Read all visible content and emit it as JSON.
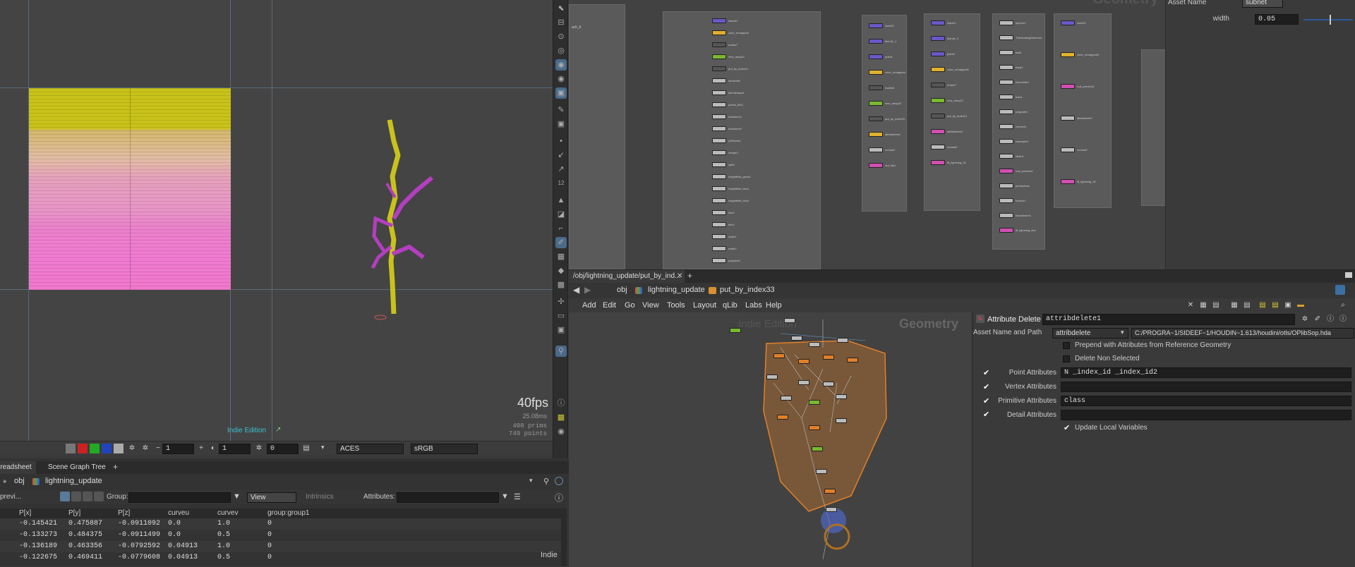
{
  "viewport": {
    "fps": "40fps",
    "ms": "25.08ms",
    "prims": "408  prims",
    "points": "749 points",
    "indie": "Indie Edition",
    "toolbar": {
      "frame_a": "1",
      "frame_b": "1",
      "frame_c": "0",
      "colorspace": "ACES",
      "display": "sRGB"
    }
  },
  "net_top": {
    "watermark": "Geometry",
    "left_label": "ach_tl",
    "nodes_b": [
      "lines30",
      "color_remapped",
      "nodes7",
      "new_ramp21",
      "put_by_index21",
      "timeshift1",
      "blendshape1",
      "points_f810",
      "transform1",
      "transform2",
      "ySDivide1",
      "merge3",
      "split1",
      "heightfield_grow3",
      "heightfield_blur1",
      "heightfield_blur2",
      "blur1",
      "blur2",
      "scale1",
      "scale2",
      "polywire2"
    ],
    "nodes_c": [
      "lines20",
      "blend1_1",
      "point1",
      "color_remapped",
      "nodes6",
      "new_ramp20",
      "put_by_index20",
      "attribdelete1",
      "normal1",
      "out_flat1"
    ],
    "nodes_d": [
      "lines21",
      "blend1_2",
      "point2",
      "color_remapped1",
      "nodes7",
      "new_ramp21",
      "put_by_index21",
      "attribdelete2",
      "normal2",
      "lft_lightning_01"
    ],
    "nodes_e": [
      "sphere1",
      "ThiefrostingDeformer",
      "trail1",
      "blast1",
      "ivtunelrite1",
      "fuse1",
      "polypath1",
      "convert1",
      "resample1",
      "clean1",
      "null_preview1",
      "ptrelaxtrian",
      "bottom1",
      "lookatmore1",
      "lft_lightning_line"
    ],
    "nodes_f": [
      "lines20",
      "color_remapped2",
      "null_preview2",
      "attribdelete7",
      "normal3",
      "lft_lightning_01"
    ]
  },
  "param_top": {
    "asset_name_label": "Asset Name",
    "asset_name_value": "subnet",
    "width_label": "width",
    "width_value": "0.05"
  },
  "right_bottom": {
    "path_tab": "/obj/lightning_update/put_by_ind...",
    "crumbs": [
      "obj",
      "lightning_update",
      "put_by_index33"
    ],
    "menu": [
      "Add",
      "Edit",
      "Go",
      "View",
      "Tools",
      "Layout",
      "qLib",
      "Labs",
      "Help"
    ],
    "watermark_indie": "Indie Edition",
    "watermark_geo": "Geometry",
    "param": {
      "type": "Attribute Delete",
      "name": "attribdelete1",
      "asset_label": "Asset Name and Path",
      "asset_value": "attribdelete",
      "asset_path": "C:/PROGRA~1/SIDEEF~1/HOUDIN~1.613/houdini/otls/OPlibSop.hda",
      "prepend_label": "Prepend with Attributes from Reference Geometry",
      "delete_non_label": "Delete Non Selected",
      "point_label": "Point Attributes",
      "point_value": "N _index_id _index_id2",
      "vertex_label": "Vertex Attributes",
      "vertex_value": "",
      "prim_label": "Primitive Attributes",
      "prim_value": "class",
      "detail_label": "Detail Attributes",
      "detail_value": "",
      "update_label": "Update Local Variables"
    }
  },
  "spreadsheet": {
    "tabs": [
      "Spreadsheet",
      "Scene Graph Tree"
    ],
    "crumbs": [
      "obj",
      "lightning_update"
    ],
    "preview_label": "previ...",
    "group_label": "Group:",
    "view_label": "View",
    "intrinsics_label": "Intrinsics",
    "attributes_label": "Attributes:",
    "indie": "Indie",
    "columns": [
      "P[x]",
      "P[y]",
      "P[z]",
      "curveu",
      "curvev",
      "group:group1"
    ],
    "rows": [
      [
        "-0.145421",
        "0.475887",
        "-0.0911092",
        "0.0",
        "1.0",
        "0"
      ],
      [
        "-0.133273",
        "0.484375",
        "-0.0911499",
        "0.0",
        "0.5",
        "0"
      ],
      [
        "-0.136189",
        "0.463356",
        "-0.0792592",
        "0.04913",
        "1.0",
        "0"
      ],
      [
        "-0.122675",
        "0.469411",
        "-0.0779608",
        "0.04913",
        "0.5",
        "0"
      ]
    ]
  }
}
